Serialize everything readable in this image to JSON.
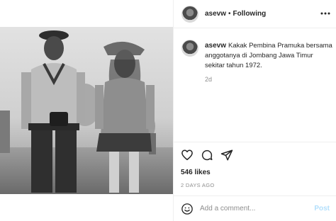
{
  "post": {
    "username": "asevw",
    "separator": "•",
    "follow_status": "Following",
    "more_icon": "more-horizontal-icon",
    "caption": {
      "username": "asevw",
      "text": "Kakak Pembina Pramuka bersama anggotanya di Jombang Jawa Timur sekitar tahun 1972.",
      "time": "2d"
    },
    "likes": "546 likes",
    "time_ago": "2 DAYS AGO",
    "comment": {
      "placeholder": "Add a comment...",
      "value": "",
      "post_label": "Post"
    },
    "icons": [
      "heart-icon",
      "comment-icon",
      "share-icon",
      "emoji-icon"
    ],
    "colors": {
      "post_button": "#b2dffc",
      "muted_text": "#8e8e8e",
      "divider": "#efefef"
    }
  }
}
